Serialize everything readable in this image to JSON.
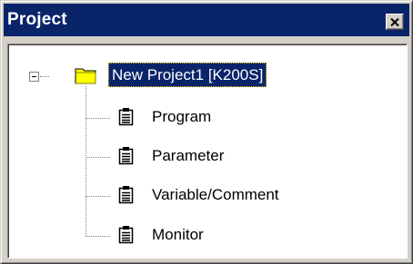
{
  "window": {
    "title": "Project"
  },
  "tree": {
    "root": {
      "label": "New Project1 [K200S]",
      "icon": "folder-icon",
      "expanded": true,
      "selected": true
    },
    "children": [
      {
        "label": "Program",
        "icon": "document-icon"
      },
      {
        "label": "Parameter",
        "icon": "document-icon"
      },
      {
        "label": "Variable/Comment",
        "icon": "document-icon"
      },
      {
        "label": "Monitor",
        "icon": "document-icon"
      }
    ]
  },
  "colors": {
    "titlebar": "#0a246a",
    "selection": "#0a246a",
    "folder": "#ffff00",
    "chrome": "#d4d0c8"
  }
}
